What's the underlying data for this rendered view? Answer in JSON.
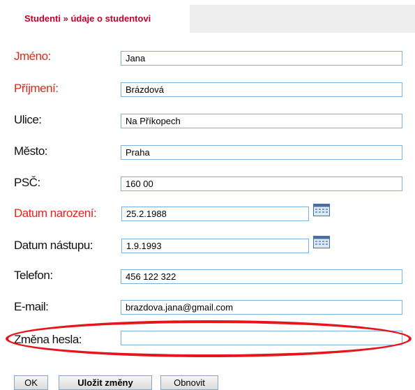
{
  "tab": {
    "title": "Studenti » údaje o studentovi"
  },
  "fields": [
    {
      "label": "Jméno:",
      "value": "Jana",
      "required": true
    },
    {
      "label": "Příjmení:",
      "value": "Brázdová",
      "required": true
    },
    {
      "label": "Ulice:",
      "value": "Na Příkopech",
      "required": false
    },
    {
      "label": "Město:",
      "value": "Praha",
      "required": false
    },
    {
      "label": "PSČ:",
      "value": "160 00",
      "required": false
    },
    {
      "label": "Datum narození:",
      "value": "25.2.1988",
      "required": true
    },
    {
      "label": "Datum nástupu:",
      "value": "1.9.1993",
      "required": false
    },
    {
      "label": "Telefon:",
      "value": "456 122 322",
      "required": false
    },
    {
      "label": "E-mail:",
      "value": "brazdova.jana@gmail.com",
      "required": false
    },
    {
      "label": "Změna hesla:",
      "value": "",
      "required": false
    }
  ],
  "buttons": {
    "ok": "OK",
    "save": "Uložit změny",
    "reset": "Obnovit"
  },
  "colors": {
    "required_label": "#e1261c",
    "tab_title": "#c0002a",
    "input_border": "#7fb0da",
    "highlight": "#e8141c"
  }
}
